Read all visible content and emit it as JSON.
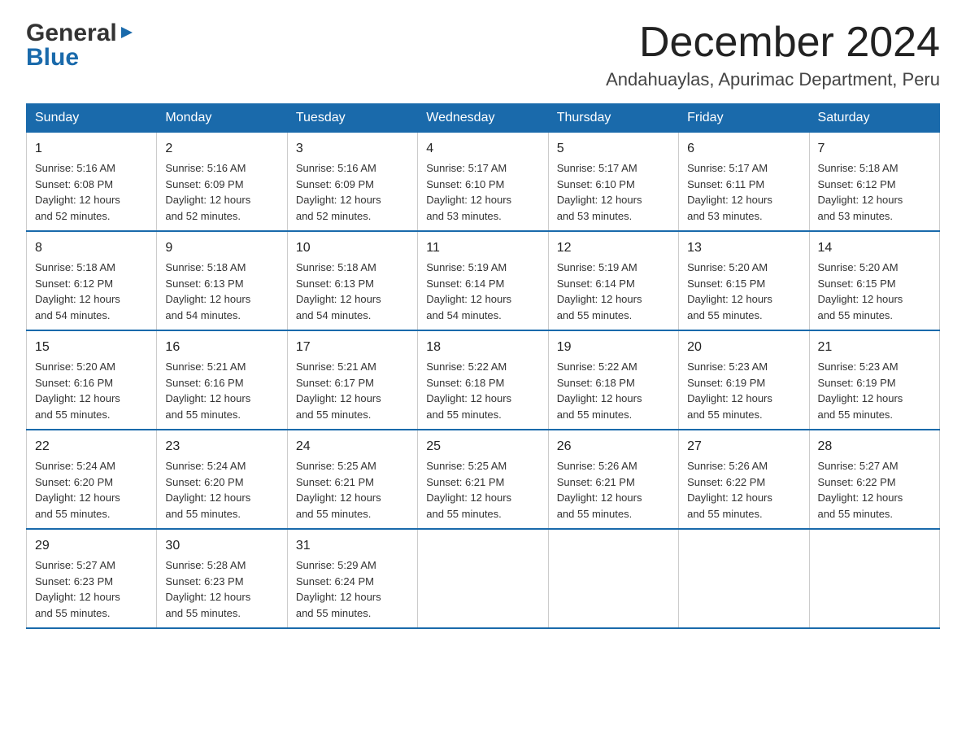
{
  "logo": {
    "general": "General",
    "blue": "Blue"
  },
  "title": "December 2024",
  "location": "Andahuaylas, Apurimac Department, Peru",
  "days_of_week": [
    "Sunday",
    "Monday",
    "Tuesday",
    "Wednesday",
    "Thursday",
    "Friday",
    "Saturday"
  ],
  "weeks": [
    [
      {
        "day": "1",
        "sunrise": "5:16 AM",
        "sunset": "6:08 PM",
        "daylight": "12 hours and 52 minutes."
      },
      {
        "day": "2",
        "sunrise": "5:16 AM",
        "sunset": "6:09 PM",
        "daylight": "12 hours and 52 minutes."
      },
      {
        "day": "3",
        "sunrise": "5:16 AM",
        "sunset": "6:09 PM",
        "daylight": "12 hours and 52 minutes."
      },
      {
        "day": "4",
        "sunrise": "5:17 AM",
        "sunset": "6:10 PM",
        "daylight": "12 hours and 53 minutes."
      },
      {
        "day": "5",
        "sunrise": "5:17 AM",
        "sunset": "6:10 PM",
        "daylight": "12 hours and 53 minutes."
      },
      {
        "day": "6",
        "sunrise": "5:17 AM",
        "sunset": "6:11 PM",
        "daylight": "12 hours and 53 minutes."
      },
      {
        "day": "7",
        "sunrise": "5:18 AM",
        "sunset": "6:12 PM",
        "daylight": "12 hours and 53 minutes."
      }
    ],
    [
      {
        "day": "8",
        "sunrise": "5:18 AM",
        "sunset": "6:12 PM",
        "daylight": "12 hours and 54 minutes."
      },
      {
        "day": "9",
        "sunrise": "5:18 AM",
        "sunset": "6:13 PM",
        "daylight": "12 hours and 54 minutes."
      },
      {
        "day": "10",
        "sunrise": "5:18 AM",
        "sunset": "6:13 PM",
        "daylight": "12 hours and 54 minutes."
      },
      {
        "day": "11",
        "sunrise": "5:19 AM",
        "sunset": "6:14 PM",
        "daylight": "12 hours and 54 minutes."
      },
      {
        "day": "12",
        "sunrise": "5:19 AM",
        "sunset": "6:14 PM",
        "daylight": "12 hours and 55 minutes."
      },
      {
        "day": "13",
        "sunrise": "5:20 AM",
        "sunset": "6:15 PM",
        "daylight": "12 hours and 55 minutes."
      },
      {
        "day": "14",
        "sunrise": "5:20 AM",
        "sunset": "6:15 PM",
        "daylight": "12 hours and 55 minutes."
      }
    ],
    [
      {
        "day": "15",
        "sunrise": "5:20 AM",
        "sunset": "6:16 PM",
        "daylight": "12 hours and 55 minutes."
      },
      {
        "day": "16",
        "sunrise": "5:21 AM",
        "sunset": "6:16 PM",
        "daylight": "12 hours and 55 minutes."
      },
      {
        "day": "17",
        "sunrise": "5:21 AM",
        "sunset": "6:17 PM",
        "daylight": "12 hours and 55 minutes."
      },
      {
        "day": "18",
        "sunrise": "5:22 AM",
        "sunset": "6:18 PM",
        "daylight": "12 hours and 55 minutes."
      },
      {
        "day": "19",
        "sunrise": "5:22 AM",
        "sunset": "6:18 PM",
        "daylight": "12 hours and 55 minutes."
      },
      {
        "day": "20",
        "sunrise": "5:23 AM",
        "sunset": "6:19 PM",
        "daylight": "12 hours and 55 minutes."
      },
      {
        "day": "21",
        "sunrise": "5:23 AM",
        "sunset": "6:19 PM",
        "daylight": "12 hours and 55 minutes."
      }
    ],
    [
      {
        "day": "22",
        "sunrise": "5:24 AM",
        "sunset": "6:20 PM",
        "daylight": "12 hours and 55 minutes."
      },
      {
        "day": "23",
        "sunrise": "5:24 AM",
        "sunset": "6:20 PM",
        "daylight": "12 hours and 55 minutes."
      },
      {
        "day": "24",
        "sunrise": "5:25 AM",
        "sunset": "6:21 PM",
        "daylight": "12 hours and 55 minutes."
      },
      {
        "day": "25",
        "sunrise": "5:25 AM",
        "sunset": "6:21 PM",
        "daylight": "12 hours and 55 minutes."
      },
      {
        "day": "26",
        "sunrise": "5:26 AM",
        "sunset": "6:21 PM",
        "daylight": "12 hours and 55 minutes."
      },
      {
        "day": "27",
        "sunrise": "5:26 AM",
        "sunset": "6:22 PM",
        "daylight": "12 hours and 55 minutes."
      },
      {
        "day": "28",
        "sunrise": "5:27 AM",
        "sunset": "6:22 PM",
        "daylight": "12 hours and 55 minutes."
      }
    ],
    [
      {
        "day": "29",
        "sunrise": "5:27 AM",
        "sunset": "6:23 PM",
        "daylight": "12 hours and 55 minutes."
      },
      {
        "day": "30",
        "sunrise": "5:28 AM",
        "sunset": "6:23 PM",
        "daylight": "12 hours and 55 minutes."
      },
      {
        "day": "31",
        "sunrise": "5:29 AM",
        "sunset": "6:24 PM",
        "daylight": "12 hours and 55 minutes."
      },
      null,
      null,
      null,
      null
    ]
  ],
  "labels": {
    "sunrise": "Sunrise:",
    "sunset": "Sunset:",
    "daylight": "Daylight:"
  },
  "colors": {
    "header_bg": "#1a6aab",
    "header_text": "#ffffff",
    "border": "#cccccc",
    "body_text": "#333333"
  }
}
